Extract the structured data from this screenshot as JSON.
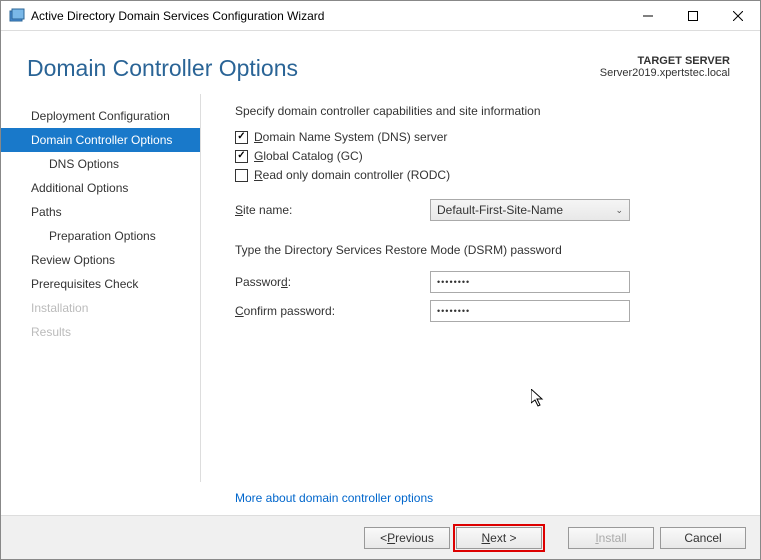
{
  "window": {
    "title": "Active Directory Domain Services Configuration Wizard"
  },
  "header": {
    "title": "Domain Controller Options",
    "target_label": "TARGET SERVER",
    "target_value": "Server2019.xpertstec.local"
  },
  "sidebar": {
    "items": [
      {
        "label": "Deployment Configuration",
        "active": false,
        "sub": false,
        "disabled": false
      },
      {
        "label": "Domain Controller Options",
        "active": true,
        "sub": false,
        "disabled": false
      },
      {
        "label": "DNS Options",
        "active": false,
        "sub": true,
        "disabled": false
      },
      {
        "label": "Additional Options",
        "active": false,
        "sub": false,
        "disabled": false
      },
      {
        "label": "Paths",
        "active": false,
        "sub": false,
        "disabled": false
      },
      {
        "label": "Preparation Options",
        "active": false,
        "sub": true,
        "disabled": false
      },
      {
        "label": "Review Options",
        "active": false,
        "sub": false,
        "disabled": false
      },
      {
        "label": "Prerequisites Check",
        "active": false,
        "sub": false,
        "disabled": false
      },
      {
        "label": "Installation",
        "active": false,
        "sub": false,
        "disabled": true
      },
      {
        "label": "Results",
        "active": false,
        "sub": false,
        "disabled": true
      }
    ]
  },
  "content": {
    "section1": "Specify domain controller capabilities and site information",
    "chk_dns": "Domain Name System (DNS) server",
    "chk_gc": "Global Catalog (GC)",
    "chk_rodc": "Read only domain controller (RODC)",
    "site_label": "Site name:",
    "site_value": "Default-First-Site-Name",
    "section2": "Type the Directory Services Restore Mode (DSRM) password",
    "password_label": "Password:",
    "password_value": "••••••••",
    "confirm_label": "Confirm password:",
    "confirm_value": "••••••••",
    "more_link": "More about domain controller options"
  },
  "buttons": {
    "previous": "< Previous",
    "next": "Next >",
    "install": "Install",
    "cancel": "Cancel"
  }
}
